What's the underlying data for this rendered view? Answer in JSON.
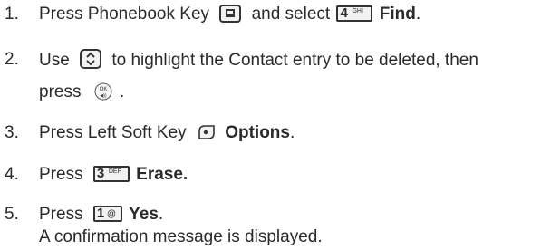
{
  "steps": [
    {
      "number": "1.",
      "parts": [
        "Press Phonebook Key",
        "and select",
        "Find",
        "."
      ],
      "keys": {
        "phonebook": "phonebook-key-icon",
        "four": {
          "big": "4",
          "small": "GHI"
        }
      }
    },
    {
      "number": "2.",
      "parts": [
        "Use",
        "to highlight the Contact entry to be deleted, then"
      ],
      "line2": [
        "press",
        "."
      ],
      "keys": {
        "nav": "nav-key-icon",
        "ok": {
          "top": "OK",
          "bottom": "◀))"
        }
      }
    },
    {
      "number": "3.",
      "parts": [
        "Press Left Soft Key",
        "Options",
        "."
      ],
      "keys": {
        "softkey": "left-soft-key-icon"
      }
    },
    {
      "number": "4.",
      "parts": [
        "Press",
        "Erase."
      ],
      "keys": {
        "three": {
          "big": "3",
          "small": "DEF"
        }
      }
    },
    {
      "number": "5.",
      "parts": [
        "Press",
        "Yes",
        "."
      ],
      "line2": [
        "A confirmation message is displayed."
      ],
      "keys": {
        "one": {
          "big": "1",
          "small": "@"
        }
      }
    }
  ]
}
